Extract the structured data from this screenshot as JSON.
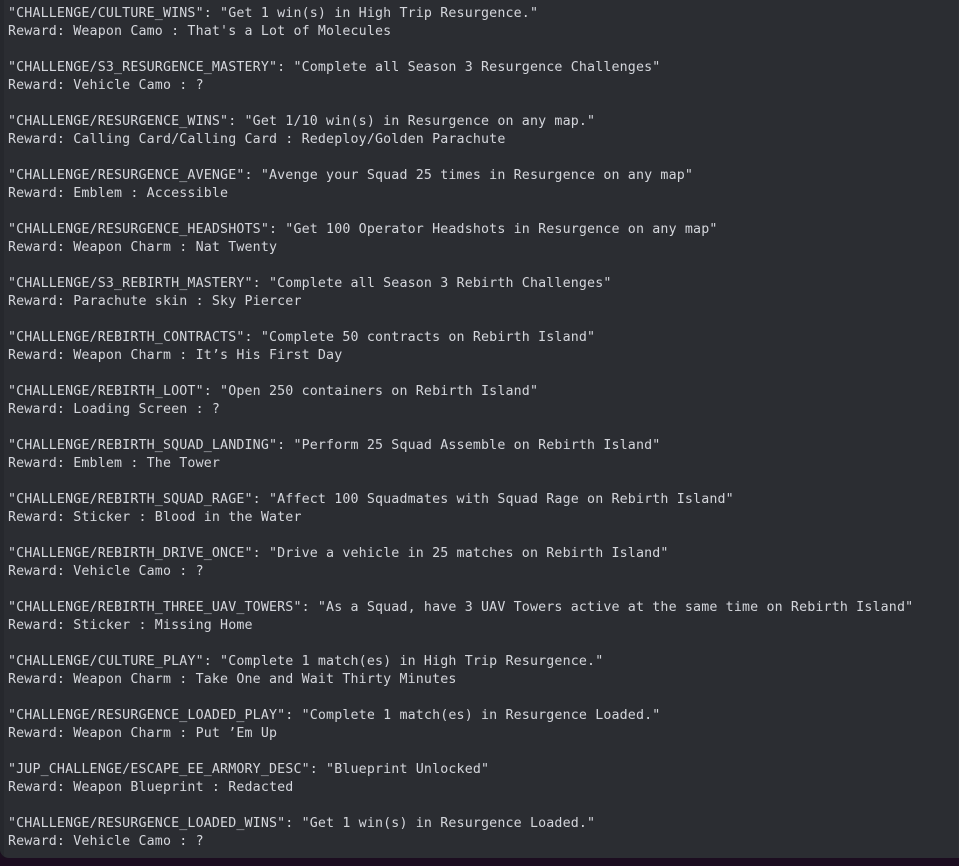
{
  "panel": {
    "title": "challenge-strings-log",
    "background_color": "#2b2d32",
    "text_color": "#d4d6dc",
    "bottom_bar_color": "#1c0d20"
  },
  "entries": [
    {
      "key_line": "\"CHALLENGE/CULTURE_WINS\": \"Get 1 win(s) in High Trip Resurgence.\"",
      "reward_line": "Reward: Weapon Camo : That's a Lot of Molecules"
    },
    {
      "key_line": "\"CHALLENGE/S3_RESURGENCE_MASTERY\": \"Complete all Season 3 Resurgence Challenges\"",
      "reward_line": "Reward: Vehicle Camo : ?"
    },
    {
      "key_line": "\"CHALLENGE/RESURGENCE_WINS\": \"Get 1/10 win(s) in Resurgence on any map.\"",
      "reward_line": "Reward: Calling Card/Calling Card : Redeploy/Golden Parachute"
    },
    {
      "key_line": "\"CHALLENGE/RESURGENCE_AVENGE\": \"Avenge your Squad 25 times in Resurgence on any map\"",
      "reward_line": "Reward: Emblem : Accessible"
    },
    {
      "key_line": "\"CHALLENGE/RESURGENCE_HEADSHOTS\": \"Get 100 Operator Headshots in Resurgence on any map\"",
      "reward_line": "Reward: Weapon Charm : Nat Twenty"
    },
    {
      "key_line": "\"CHALLENGE/S3_REBIRTH_MASTERY\": \"Complete all Season 3 Rebirth Challenges\"",
      "reward_line": "Reward: Parachute skin : Sky Piercer"
    },
    {
      "key_line": "\"CHALLENGE/REBIRTH_CONTRACTS\": \"Complete 50 contracts on Rebirth Island\"",
      "reward_line": "Reward: Weapon Charm : It’s His First Day"
    },
    {
      "key_line": "\"CHALLENGE/REBIRTH_LOOT\": \"Open 250 containers on Rebirth Island\"",
      "reward_line": "Reward: Loading Screen : ?"
    },
    {
      "key_line": "\"CHALLENGE/REBIRTH_SQUAD_LANDING\": \"Perform 25 Squad Assemble on Rebirth Island\"",
      "reward_line": "Reward: Emblem : The Tower"
    },
    {
      "key_line": "\"CHALLENGE/REBIRTH_SQUAD_RAGE\": \"Affect 100 Squadmates with Squad Rage on Rebirth Island\"",
      "reward_line": "Reward: Sticker : Blood in the Water"
    },
    {
      "key_line": "\"CHALLENGE/REBIRTH_DRIVE_ONCE\": \"Drive a vehicle in 25 matches on Rebirth Island\"",
      "reward_line": "Reward: Vehicle Camo : ?"
    },
    {
      "key_line": "\"CHALLENGE/REBIRTH_THREE_UAV_TOWERS\": \"As a Squad, have 3 UAV Towers active at the same time on Rebirth Island\"",
      "reward_line": "Reward: Sticker : Missing Home"
    },
    {
      "key_line": "\"CHALLENGE/CULTURE_PLAY\": \"Complete 1 match(es) in High Trip Resurgence.\"",
      "reward_line": "Reward: Weapon Charm : Take One and Wait Thirty Minutes"
    },
    {
      "key_line": "\"CHALLENGE/RESURGENCE_LOADED_PLAY\": \"Complete 1 match(es) in Resurgence Loaded.\"",
      "reward_line": "Reward: Weapon Charm : Put ’Em Up"
    },
    {
      "key_line": "\"JUP_CHALLENGE/ESCAPE_EE_ARMORY_DESC\": \"Blueprint Unlocked\"",
      "reward_line": "Reward: Weapon Blueprint : Redacted"
    },
    {
      "key_line": "\"CHALLENGE/RESURGENCE_LOADED_WINS\": \"Get 1 win(s) in Resurgence Loaded.\"",
      "reward_line": "Reward: Vehicle Camo : ?"
    }
  ]
}
